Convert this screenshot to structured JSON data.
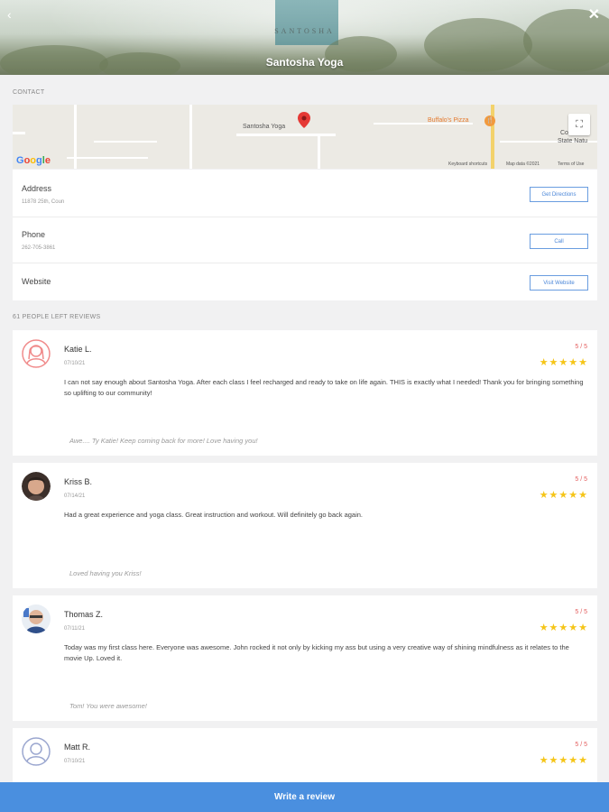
{
  "header": {
    "brand": "SANTOSHA",
    "title": "Santosha Yoga",
    "back_icon": "‹",
    "close_icon": "✕"
  },
  "contact": {
    "section_label": "CONTACT",
    "map": {
      "place_label": "Santosha Yoga",
      "poi_label": "Buffalo's Pizza",
      "edge_label_1": "Co",
      "edge_label_2": "State Natu",
      "google_logo": "Google",
      "attribution": [
        "Keyboard shortcuts",
        "Map data ©2021",
        "Terms of Use"
      ],
      "fullscreen_icon": "⛶"
    },
    "rows": [
      {
        "label": "Address",
        "value": "11878 25th, Coun",
        "button": "Get Directions"
      },
      {
        "label": "Phone",
        "value": "262-705-3861",
        "button": "Call"
      },
      {
        "label": "Website",
        "value": "",
        "button": "Visit Website"
      }
    ]
  },
  "reviews_label": "61 PEOPLE LEFT REVIEWS",
  "reviews": [
    {
      "name": "Katie L.",
      "date": "07/10/21",
      "score": "5 / 5",
      "stars": "★★★★★",
      "text": "I can not say enough about Santosha Yoga. After each class I feel recharged and ready to take on life again. THIS is exactly what I needed! Thank you for bringing something so uplifting to our community!",
      "reply": "Awe.... Ty Katie! Keep coming back for more! Love having you!"
    },
    {
      "name": "Kriss B.",
      "date": "07/14/21",
      "score": "5 / 5",
      "stars": "★★★★★",
      "text": "Had a great experience and yoga class. Great instruction and workout. Will definitely go back again.",
      "reply": "Loved having you Kriss!"
    },
    {
      "name": "Thomas Z.",
      "date": "07/11/21",
      "score": "5 / 5",
      "stars": "★★★★★",
      "text": "Today was my first class here. Everyone was awesome. John rocked it not only by kicking my ass but using a very creative way of shining mindfulness as it relates to the movie Up. Loved it.",
      "reply": "Tom! You were awesome!"
    },
    {
      "name": "Matt R.",
      "date": "07/10/21",
      "score": "5 / 5",
      "stars": "★★★★★",
      "text": "",
      "reply": ""
    }
  ],
  "write_review_label": "Write a review",
  "colors": {
    "accent": "#4a8fdf",
    "star": "#f5c518",
    "score": "#e35b5b",
    "avatar_female": "#f08a8a",
    "avatar_male": "#9aa6cf"
  }
}
